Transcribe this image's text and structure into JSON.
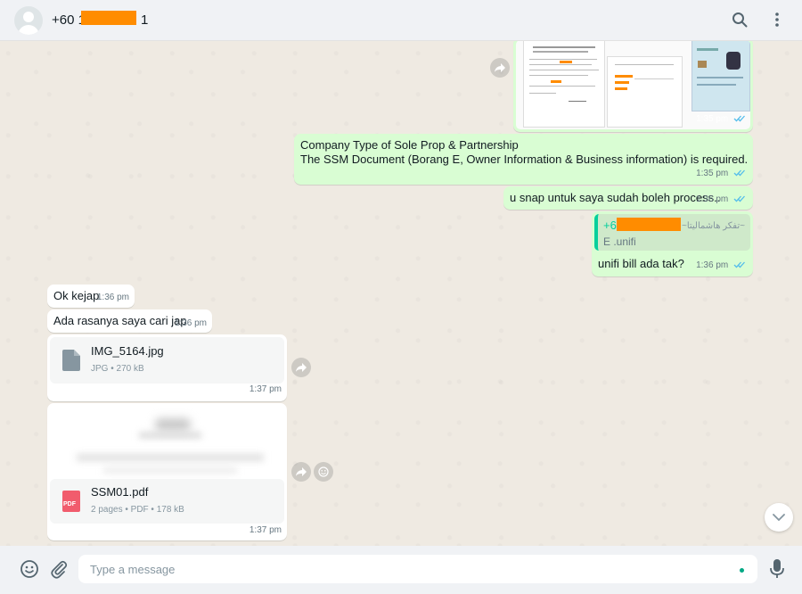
{
  "header": {
    "contact_prefix": "+60 1",
    "contact_suffix": "1"
  },
  "messages": {
    "image_time": "1:35 pm",
    "company_line1": "Company Type of Sole Prop & Partnership",
    "company_line2": "The SSM Document (Borang E, Owner Information & Business information) is required.",
    "company_time": "1:35 pm",
    "snap_text": "u snap untuk saya sudah boleh process..",
    "snap_time": "1:36 pm",
    "reply_sender": "+6",
    "reply_name_script": "~تفكر هاشماليتا~",
    "reply_quote": "E .unifi",
    "reply_text": "unifi bill ada tak?",
    "reply_time": "1:36 pm",
    "ok_text": "Ok kejap",
    "ok_time": "1:36 pm",
    "ada_text": "Ada rasanya saya cari jap",
    "ada_time": "1:36 pm",
    "file1_name": "IMG_5164.jpg",
    "file1_meta": "JPG • 270 kB",
    "file1_time": "1:37 pm",
    "file2_name": "SSM01.pdf",
    "file2_meta": "2 pages • PDF • 178 kB",
    "file2_time": "1:37 pm",
    "pdf_badge": "PDF"
  },
  "composer": {
    "placeholder": "Type a message"
  },
  "colors": {
    "outgoing_bubble": "#d9fdd3",
    "incoming_bubble": "#ffffff",
    "read_ticks": "#53bdeb",
    "redaction": "#ff8c00",
    "background": "#efeae2"
  }
}
